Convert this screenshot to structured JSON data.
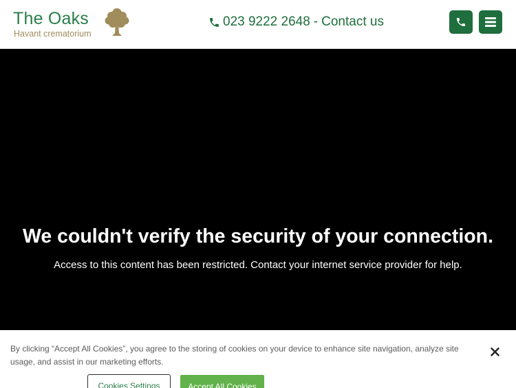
{
  "header": {
    "logo_title": "The Oaks",
    "logo_subtitle": "Havant crematorium",
    "phone_number": "023 9222 2648",
    "separator": "-",
    "contact_label": "Contact us"
  },
  "blocked": {
    "title": "We couldn't verify the security of your connection.",
    "message": "Access to this content has been restricted. Contact your internet service provider for help."
  },
  "cookie_banner": {
    "text": "By clicking “Accept All Cookies”, you agree to the storing of cookies on your device to enhance site navigation, analyze site usage, and assist in our marketing efforts.",
    "settings_label": "Cookies Settings",
    "accept_label": "Accept All Cookies"
  },
  "icons": {
    "phone": "phone-icon",
    "menu": "hamburger-menu-icon",
    "close": "close-icon",
    "logo": "oak-tree-icon"
  },
  "colors": {
    "brand_green": "#1f6e3d",
    "logo_green": "#2a7d4a",
    "gold": "#a08d5b",
    "accept_green": "#61b24a",
    "panel_black": "#000000"
  }
}
